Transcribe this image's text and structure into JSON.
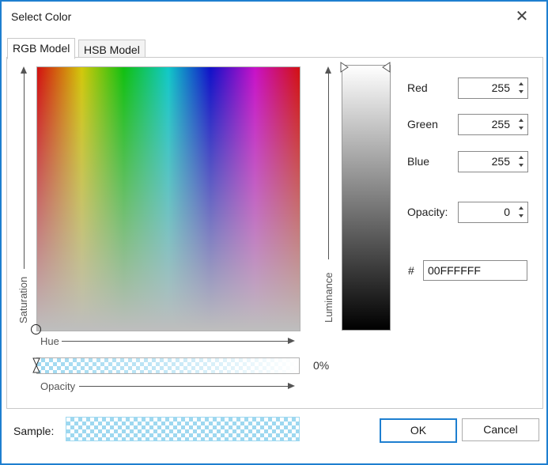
{
  "window": {
    "title": "Select Color",
    "close_icon": "close-icon"
  },
  "tabs": [
    {
      "label": "RGB Model",
      "active": true
    },
    {
      "label": "HSB Model",
      "active": false
    }
  ],
  "spectrum": {
    "y_axis_label": "Saturation",
    "x_axis_label": "Hue"
  },
  "opacity_slider": {
    "axis_label": "Opacity",
    "value_label": "0%",
    "value_percent": 0
  },
  "luminance": {
    "axis_label": "Luminance",
    "value_fraction": 1.0
  },
  "fields": {
    "red": {
      "label": "Red",
      "value": "255"
    },
    "green": {
      "label": "Green",
      "value": "255"
    },
    "blue": {
      "label": "Blue",
      "value": "255"
    },
    "opacity": {
      "label": "Opacity:",
      "value": "0"
    },
    "hex": {
      "label": "#",
      "value": "00FFFFFF"
    }
  },
  "sample": {
    "label": "Sample:"
  },
  "buttons": {
    "ok": "OK",
    "cancel": "Cancel"
  },
  "colors": {
    "accent": "#1e7fd0",
    "checker": "#9ed8f0"
  }
}
